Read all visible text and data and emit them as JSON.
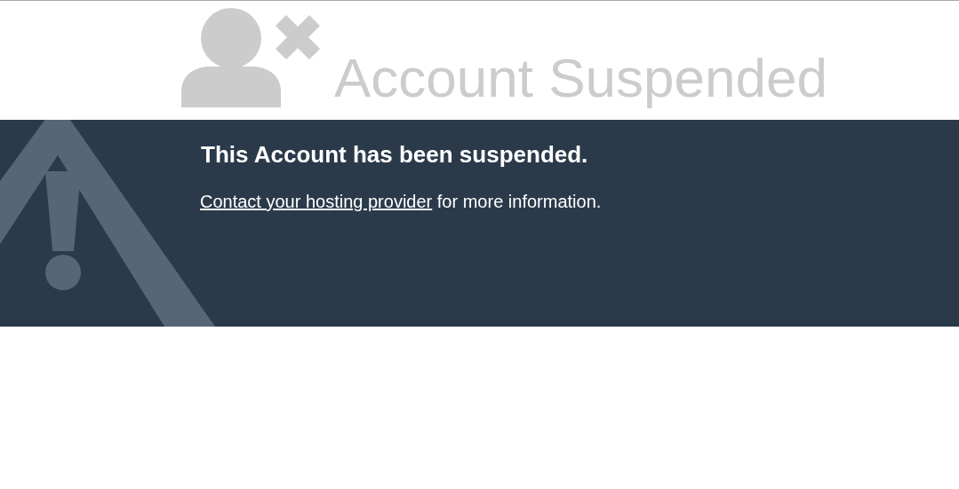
{
  "header": {
    "title": "Account Suspended"
  },
  "notice": {
    "heading": "This Account has been suspended.",
    "link": "Contact your hosting provider",
    "text": " for more information."
  }
}
